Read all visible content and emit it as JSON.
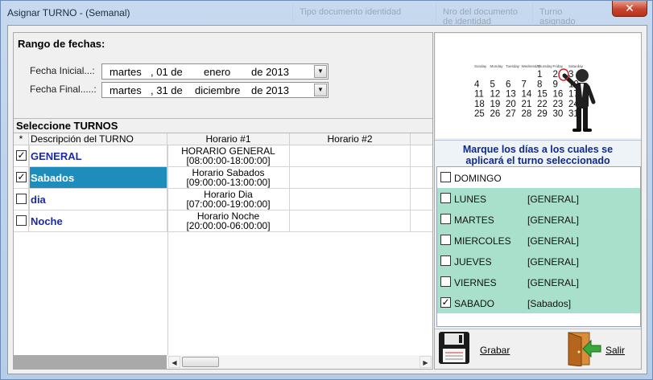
{
  "window": {
    "title": "Asignar TURNO - (Semanal)",
    "close_label": "✕",
    "background_hints": [
      "Tipo documento identidad",
      "Nro del documento de identidad",
      "Turno asignado"
    ]
  },
  "fechas": {
    "title": "Rango de fechas:",
    "inicial": {
      "label": "Fecha Inicial...:",
      "dia": "martes",
      "num": ", 01 de",
      "mes": "enero",
      "anio": "de 2013"
    },
    "final": {
      "label": "Fecha Final.....:",
      "dia": "martes",
      "num": ", 31 de",
      "mes": "diciembre",
      "anio": "de 2013"
    }
  },
  "turnos": {
    "title": "Seleccione TURNOS",
    "columns": [
      "*",
      "Descripción del TURNO",
      "Horario #1",
      "Horario #2"
    ],
    "rows": [
      {
        "checked": true,
        "name": "GENERAL",
        "h1_name": "HORARIO GENERAL",
        "h1_time": "[08:00:00-18:00:00]",
        "selected": false
      },
      {
        "checked": true,
        "name": "Sabados",
        "h1_name": "Horario Sabados",
        "h1_time": "[09:00:00-13:00:00]",
        "selected": true
      },
      {
        "checked": false,
        "name": "dia",
        "h1_name": "Horario Dia",
        "h1_time": "[07:00:00-19:00:00]",
        "selected": false
      },
      {
        "checked": false,
        "name": "Noche",
        "h1_name": "Horario Noche",
        "h1_time": "[20:00:00-06:00:00]",
        "selected": false
      }
    ]
  },
  "calendar": {
    "weekdays": [
      "Sunday",
      "Monday",
      "Tuesday",
      "Wednesday",
      "Thursday",
      "Friday",
      "Saturday"
    ],
    "weeks": [
      [
        "",
        "",
        "",
        "",
        "1",
        "2",
        "3"
      ],
      [
        "4",
        "5",
        "6",
        "7",
        "8",
        "9",
        "10"
      ],
      [
        "11",
        "12",
        "13",
        "14",
        "15",
        "16",
        "17"
      ],
      [
        "18",
        "19",
        "20",
        "21",
        "22",
        "23",
        "24"
      ],
      [
        "25",
        "26",
        "27",
        "28",
        "29",
        "30",
        "31"
      ]
    ]
  },
  "dias": {
    "prompt_line1": "Marque los días a los cuales se",
    "prompt_line2": "aplicará el turno seleccionado",
    "items": [
      {
        "name": "DOMINGO",
        "turno": "",
        "checked": false,
        "assigned": false
      },
      {
        "name": "LUNES",
        "turno": "[GENERAL]",
        "checked": false,
        "assigned": true
      },
      {
        "name": "MARTES",
        "turno": "[GENERAL]",
        "checked": false,
        "assigned": true
      },
      {
        "name": "MIERCOLES",
        "turno": "[GENERAL]",
        "checked": false,
        "assigned": true
      },
      {
        "name": "JUEVES",
        "turno": "[GENERAL]",
        "checked": false,
        "assigned": true
      },
      {
        "name": "VIERNES",
        "turno": "[GENERAL]",
        "checked": false,
        "assigned": true
      },
      {
        "name": "SABADO",
        "turno": "[Sabados]",
        "checked": true,
        "assigned": true
      }
    ]
  },
  "actions": {
    "grabar": "Grabar",
    "salir": "Salir"
  },
  "colors": {
    "selected_row": "#1f8dbb",
    "assigned_day": "#a9e0cc",
    "turno_name": "#1a2aa8"
  }
}
